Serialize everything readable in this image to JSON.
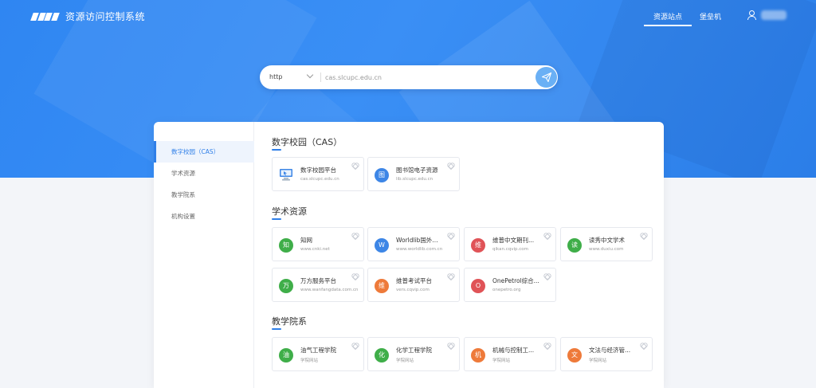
{
  "header": {
    "app_title": "资源访问控制系统",
    "nav": [
      {
        "label": "资源站点",
        "active": true
      },
      {
        "label": "堡垒机",
        "active": false
      }
    ],
    "user_name": ""
  },
  "search": {
    "protocol": "http",
    "value": "cas.slcupc.edu.cn"
  },
  "sidebar": {
    "items": [
      {
        "label": "数字校园（CAS）",
        "active": true
      },
      {
        "label": "学术资源",
        "active": false
      },
      {
        "label": "教学院系",
        "active": false
      },
      {
        "label": "机构设置",
        "active": false
      }
    ]
  },
  "colors": {
    "accent": "#2f7fe8",
    "hero": "#2f86f2",
    "icon_blue": "#3d86e6",
    "icon_green": "#3fae49",
    "icon_red": "#e05357",
    "icon_orange": "#ee7a3a"
  },
  "sections": [
    {
      "title": "数字校园（CAS）",
      "cards": [
        {
          "name": "数字校园平台",
          "url": "cas.slcupc.edu.cn",
          "icon": "monitor-icon",
          "glyph": ""
        },
        {
          "name": "图书馆电子资源",
          "url": "lib.slcupc.edu.cn",
          "icon": "library-icon",
          "glyph": "图"
        }
      ]
    },
    {
      "title": "学术资源",
      "cards": [
        {
          "name": "知网",
          "url": "www.cnki.net",
          "icon": "cnki-icon",
          "glyph": "知"
        },
        {
          "name": "Worldlib国外...",
          "url": "www.worldlib.com.cn",
          "icon": "worldlib-icon",
          "glyph": "W"
        },
        {
          "name": "维普中文期刊...",
          "url": "qikan.cqvip.com",
          "icon": "cqvip-icon",
          "glyph": "维"
        },
        {
          "name": "读秀中文学术",
          "url": "www.duxiu.com",
          "icon": "duxiu-icon",
          "glyph": "读"
        },
        {
          "name": "万方服务平台",
          "url": "www.wanfangdata.com.cn",
          "icon": "wanfang-icon",
          "glyph": "万"
        },
        {
          "name": "维普考试平台",
          "url": "vers.cqvip.com",
          "icon": "vers-icon",
          "glyph": "维"
        },
        {
          "name": "OnePetrol综合...",
          "url": "onepetro.org",
          "icon": "onepetro-icon",
          "glyph": "O"
        }
      ]
    },
    {
      "title": "教学院系",
      "cards": [
        {
          "name": "油气工程学院",
          "url": "学院网站",
          "icon": "oil-gas-icon",
          "glyph": "油"
        },
        {
          "name": "化学工程学院",
          "url": "学院网站",
          "icon": "chem-icon",
          "glyph": "化"
        },
        {
          "name": "机械与控制工...",
          "url": "学院网站",
          "icon": "mech-icon",
          "glyph": "机"
        },
        {
          "name": "文法与经济管...",
          "url": "学院网站",
          "icon": "law-econ-icon",
          "glyph": "文"
        }
      ]
    }
  ]
}
